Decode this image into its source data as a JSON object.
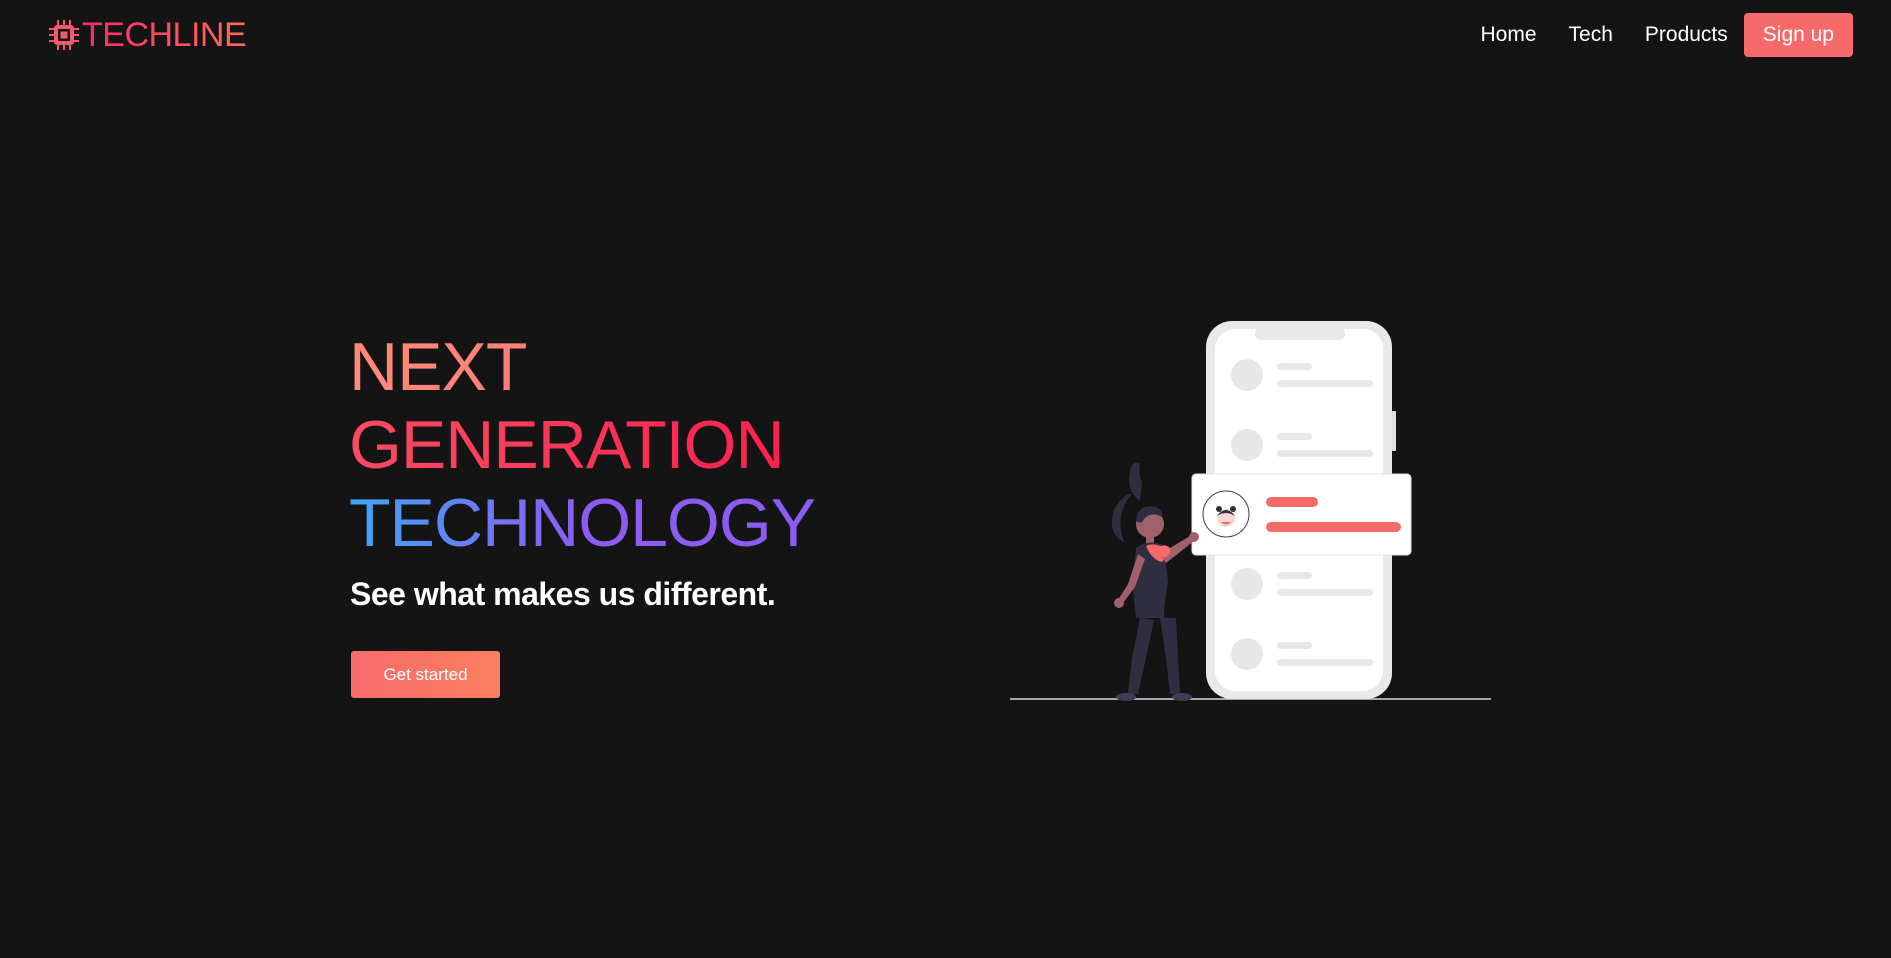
{
  "brand": {
    "name": "TECHLINE",
    "icon": "chip-icon",
    "color": "#f45a6b"
  },
  "nav": {
    "links": [
      "Home",
      "Tech",
      "Products"
    ],
    "signup_label": "Sign up"
  },
  "hero": {
    "line1": "NEXT",
    "line2": "GENERATION",
    "line3": "TECHNOLOGY",
    "subtitle": "See what makes us different.",
    "cta_label": "Get started"
  },
  "illustration": {
    "name": "woman-with-phone-illustration"
  },
  "colors": {
    "background": "#141414",
    "accent": "#f66a6a",
    "gradient_blue": "#3fa5f7",
    "gradient_purple": "#8b5cf6"
  }
}
